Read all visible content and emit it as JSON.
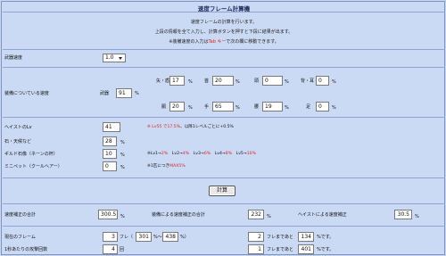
{
  "title": "速度フレーム計算機",
  "intro": {
    "line1": "速度フレームの計算を行います。",
    "line2": "上段の情報を全て入力し、計算ボタンを押すと下段に結果が出ます。",
    "line3_pre": "※装備速度の入力は",
    "line3_red": "Tab キー",
    "line3_post": "で次の欄に移動できます。"
  },
  "colors": {
    "background": "#c9d8f2",
    "red": "#e02020",
    "rule": "#8fa4cf"
  },
  "attack_speed": {
    "label": "武器速度",
    "value": "1.0"
  },
  "equip_speed": {
    "label": "装備についている速度",
    "weapon_label": "武器",
    "weapon_value": "91",
    "weapon_unit": "%",
    "slots": [
      {
        "label": "矢・盾",
        "value": "17",
        "unit": "%"
      },
      {
        "label": "首",
        "value": "20",
        "unit": "%"
      },
      {
        "label": "頭",
        "value": "0",
        "unit": "%"
      },
      {
        "label": "背・耳",
        "value": "0",
        "unit": "%"
      },
      {
        "label": "胴",
        "value": "20",
        "unit": "%"
      },
      {
        "label": "手",
        "value": "65",
        "unit": "%"
      },
      {
        "label": "腰",
        "value": "19",
        "unit": "%"
      },
      {
        "label": "足",
        "value": "0",
        "unit": "%"
      }
    ]
  },
  "haste": {
    "label": "ヘイストのLv",
    "value": "41",
    "note_red": "※ Lv55 で17.5%",
    "note_rest": "、以降1レベルごとに+0.5%"
  },
  "attack_bonus": {
    "label": "石・天候など",
    "value": "28",
    "unit": "%"
  },
  "guild": {
    "label": "ギルド石像（ネーンの杯）",
    "value": "10",
    "unit": "%",
    "note_parts": [
      {
        "text": "※Lv1→",
        "red": false
      },
      {
        "text": "2%",
        "red": true
      },
      {
        "text": "　Lv2→",
        "red": false
      },
      {
        "text": "4%",
        "red": true
      },
      {
        "text": "　Lv3→",
        "red": false
      },
      {
        "text": "6%",
        "red": true
      },
      {
        "text": "　Lv4→",
        "red": false
      },
      {
        "text": "8%",
        "red": true
      },
      {
        "text": "　Lv5→",
        "red": false
      },
      {
        "text": "10%",
        "red": true
      }
    ]
  },
  "minipet": {
    "label": "ミニペット（クールヘアー）",
    "value": "0",
    "unit": "%",
    "note_pre": "※1匹につき",
    "note_red": "MAX5%"
  },
  "calc_button": "計算",
  "results": {
    "speed_total_label": "速度補正の合計",
    "speed_total_value": "300.5",
    "speed_total_unit": "%",
    "equip_total_label": "装備による速度補正の合計",
    "equip_total_value": "232",
    "equip_total_unit": "%",
    "haste_corr_label": "ヘイストによる速度補正",
    "haste_corr_value": "30.5",
    "haste_corr_unit": "%",
    "frames_label": "現在のフレーム",
    "frames_value": "3",
    "frames_mid": "フレ（",
    "frames_low": "301",
    "frames_sep": "%～",
    "frames_high": "438",
    "frames_end": "%）",
    "frames2_value": "2",
    "frames2_mid": "フレまであと",
    "frames2_diff": "134",
    "frames2_end": "%です。",
    "attacks_label": "1秒あたりの攻撃回数",
    "attacks_value": "4",
    "attacks_unit": "回",
    "frames3_value": "1",
    "frames3_mid": "フレまであと",
    "frames3_diff": "401",
    "frames3_end": "%です。"
  }
}
